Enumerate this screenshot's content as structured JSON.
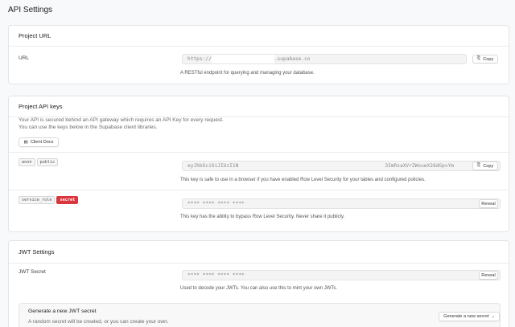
{
  "page": {
    "title": "API Settings"
  },
  "project_url": {
    "header": "Project URL",
    "label": "URL",
    "value_prefix": "https://",
    "value_suffix": ".supabase.co",
    "copy_label": "Copy",
    "help": "A RESTful endpoint for querying and managing your database."
  },
  "api_keys": {
    "header": "Project API keys",
    "desc_line1": "Your API is secured behind an API gateway which requires an API Key for every request.",
    "desc_line2": "You can use the keys below in the Supabase client libraries.",
    "client_docs_label": "Client Docs",
    "anon": {
      "tags": [
        "anon",
        "public"
      ],
      "value_left": "eyJhbGciOiJIUzI1N",
      "value_right": "3ImRsaXVrZWxueX26dGpvYm",
      "copy_label": "Copy",
      "help": "This key is safe to use in a browser if you have enabled Row Level Security for your tables and configured policies."
    },
    "service_role": {
      "tag": "service_role",
      "secret_tag": "secret",
      "value": "**** **** **** ****",
      "reveal_label": "Reveal",
      "help": "This key has the ability to bypass Row Level Security. Never share it publicly."
    }
  },
  "jwt": {
    "header": "JWT Settings",
    "secret_label": "JWT Secret",
    "secret_value": "**** **** **** ****",
    "reveal_label": "Reveal",
    "help": "Used to decode your JWTs. You can also use this to mint your own JWTs.",
    "generate": {
      "title": "Generate a new JWT secret",
      "desc": "A random secret will be created, or you can create your own.",
      "button_label": "Generate a new secret"
    }
  }
}
